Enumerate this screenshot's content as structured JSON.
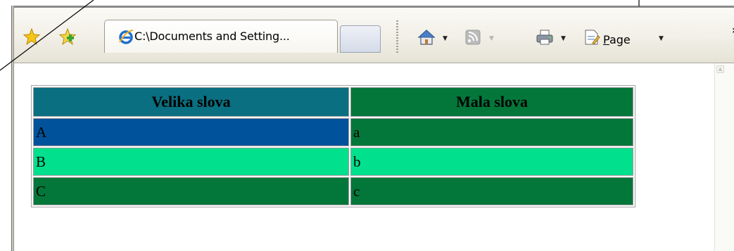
{
  "browser": {
    "tab": {
      "title": "C:\\Documents and Setting..."
    },
    "toolbar": {
      "page_menu_accesskey": "P",
      "page_menu_rest": "age",
      "overflow": "»"
    }
  },
  "colors": {
    "header_left": "#0a6f80",
    "header_right": "#03773a",
    "row_a_left": "#00529b",
    "row_a_right": "#03773a",
    "row_b": "#01e08c",
    "row_c": "#03773a"
  },
  "table": {
    "headers": [
      "Velika slova",
      "Mala slova"
    ],
    "rows": [
      [
        "A",
        "a"
      ],
      [
        "B",
        "b"
      ],
      [
        "C",
        "c"
      ]
    ]
  }
}
